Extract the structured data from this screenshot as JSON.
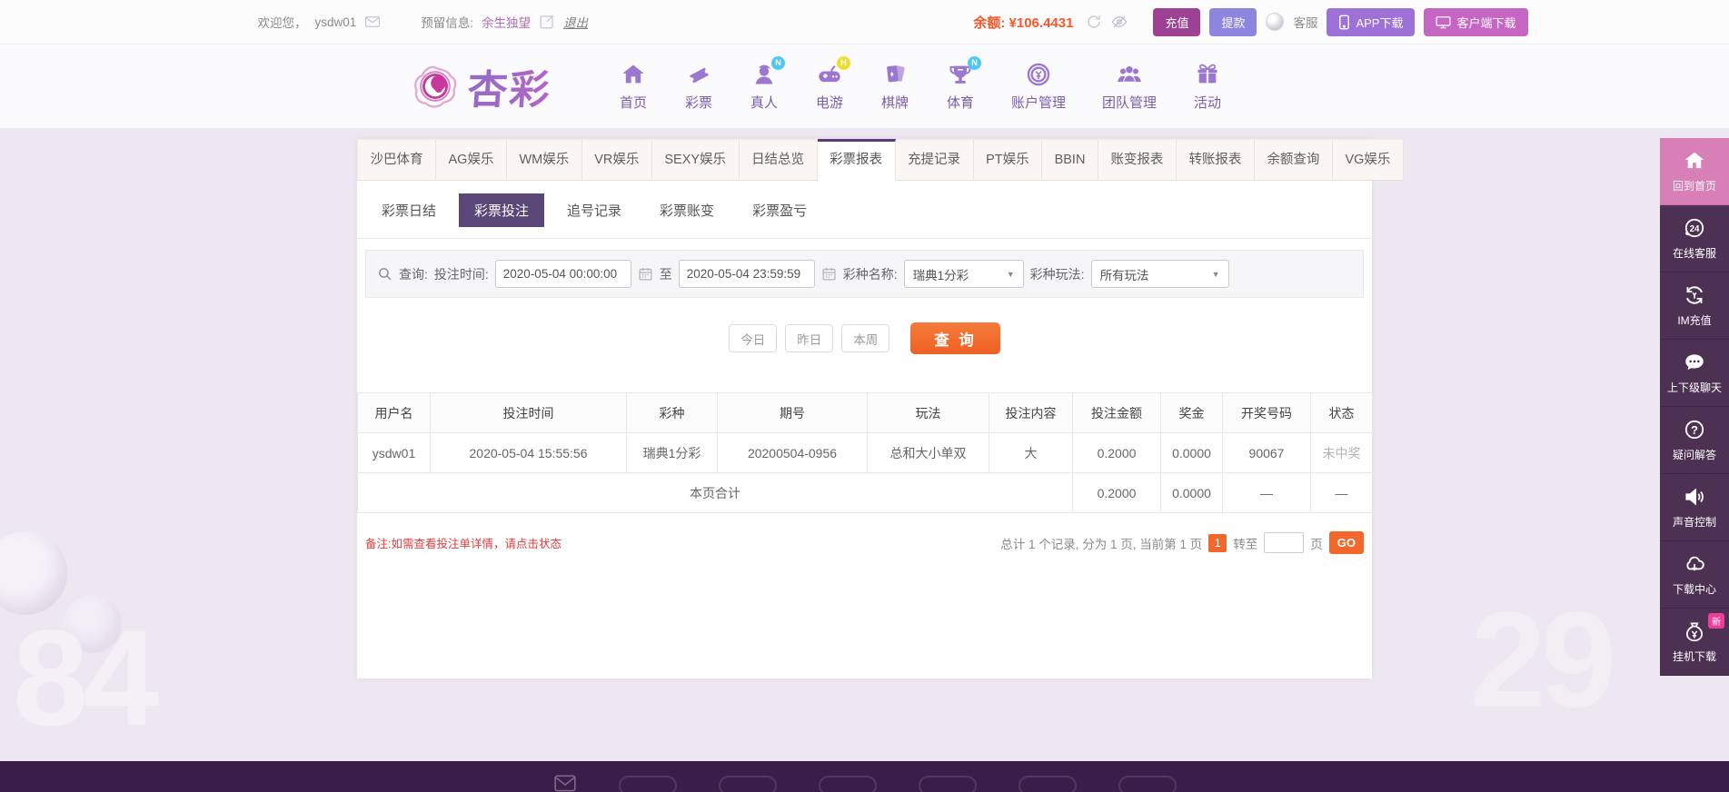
{
  "topbar": {
    "welcome_prefix": "欢迎您，",
    "username": "ysdw01",
    "reserved_label": "预留信息:",
    "reserved_value": "余生独望",
    "logout": "退出",
    "balance_label": "余额:",
    "balance_value": "¥106.4431",
    "recharge": "充值",
    "withdraw": "提款",
    "service": "客服",
    "app_download": "APP下载",
    "client_download": "客户端下载"
  },
  "nav": {
    "logo_text": "杏彩",
    "items": [
      {
        "label": "首页",
        "icon": "home-icon",
        "badge": ""
      },
      {
        "label": "彩票",
        "icon": "ticket-icon",
        "badge": ""
      },
      {
        "label": "真人",
        "icon": "live-person-icon",
        "badge": "N"
      },
      {
        "label": "电游",
        "icon": "gamepad-icon",
        "badge": "H"
      },
      {
        "label": "棋牌",
        "icon": "cards-icon",
        "badge": ""
      },
      {
        "label": "体育",
        "icon": "trophy-icon",
        "badge": "N"
      },
      {
        "label": "账户管理",
        "icon": "coin-icon",
        "badge": ""
      },
      {
        "label": "团队管理",
        "icon": "team-icon",
        "badge": ""
      },
      {
        "label": "活动",
        "icon": "gift-icon",
        "badge": ""
      }
    ]
  },
  "tabs": {
    "active": "彩票报表",
    "items": [
      "沙巴体育",
      "AG娱乐",
      "WM娱乐",
      "VR娱乐",
      "SEXY娱乐",
      "日结总览",
      "彩票报表",
      "充提记录",
      "PT娱乐",
      "BBIN",
      "账变报表",
      "转账报表",
      "余额查询",
      "VG娱乐"
    ]
  },
  "subtabs": {
    "active": "彩票投注",
    "items": [
      "彩票日结",
      "彩票投注",
      "追号记录",
      "彩票账变",
      "彩票盈亏"
    ]
  },
  "filter": {
    "search_label": "查询:",
    "time_label": "投注时间:",
    "time_from": "2020-05-04 00:00:00",
    "to_label": "至",
    "time_to": "2020-05-04 23:59:59",
    "lottery_label": "彩种名称:",
    "lottery_value": "瑞典1分彩",
    "play_label": "彩种玩法:",
    "play_value": "所有玩法",
    "today": "今日",
    "yesterday": "昨日",
    "week": "本周",
    "search_button": "查 询"
  },
  "table": {
    "headers": [
      "用户名",
      "投注时间",
      "彩种",
      "期号",
      "玩法",
      "投注内容",
      "投注金额",
      "奖金",
      "开奖号码",
      "状态"
    ],
    "rows": [
      [
        "ysdw01",
        "2020-05-04 15:55:56",
        "瑞典1分彩",
        "20200504-0956",
        "总和大小单双",
        "大",
        "0.2000",
        "0.0000",
        "90067",
        "未中奖"
      ]
    ],
    "summary": {
      "label": "本页合计",
      "amount": "0.2000",
      "bonus": "0.0000",
      "draw_dash": "—",
      "status_dash": "—"
    }
  },
  "note": "备注:如需查看投注单详情，请点击状态",
  "pagination": {
    "info": "总计 1 个记录, 分为 1 页, 当前第 1 页",
    "page_badge": "1",
    "goto_label": "转至",
    "page_suffix": "页",
    "go": "GO"
  },
  "sidebar": {
    "items": [
      {
        "label": "回到首页",
        "icon": "home-icon",
        "active": true,
        "badge": ""
      },
      {
        "label": "在线客服",
        "icon": "service-24h-icon",
        "active": false,
        "badge": ""
      },
      {
        "label": "IM充值",
        "icon": "im-recharge-icon",
        "active": false,
        "badge": ""
      },
      {
        "label": "上下级聊天",
        "icon": "chat-icon",
        "active": false,
        "badge": ""
      },
      {
        "label": "疑问解答",
        "icon": "question-icon",
        "active": false,
        "badge": ""
      },
      {
        "label": "声音控制",
        "icon": "sound-icon",
        "active": false,
        "badge": ""
      },
      {
        "label": "下载中心",
        "icon": "download-icon",
        "active": false,
        "badge": ""
      },
      {
        "label": "挂机下载",
        "icon": "moneybag-icon",
        "active": false,
        "badge": "新"
      }
    ]
  },
  "decor": {
    "num_left": "84",
    "num_right": "29"
  },
  "colors": {
    "accent_orange": "#f2682c",
    "balance_red": "#f4582c",
    "purple_dark": "#5a4777",
    "tab_indicator": "#5c3a78",
    "recharge_btn": "#9c4193",
    "withdraw_btn": "#8d86e0",
    "app_btn": "#9d71d5",
    "client_btn": "#c666c4",
    "sidebar_bg": "#4d3153",
    "sidebar_active": "#d77fb6",
    "badge_new": "#ef3d9a",
    "badge_n": "#4ec9f5",
    "badge_h": "#f2dd2e",
    "note_red": "#e03c3c",
    "footer_bg": "#3a1d49",
    "nav_purple": "#9c77cf"
  }
}
